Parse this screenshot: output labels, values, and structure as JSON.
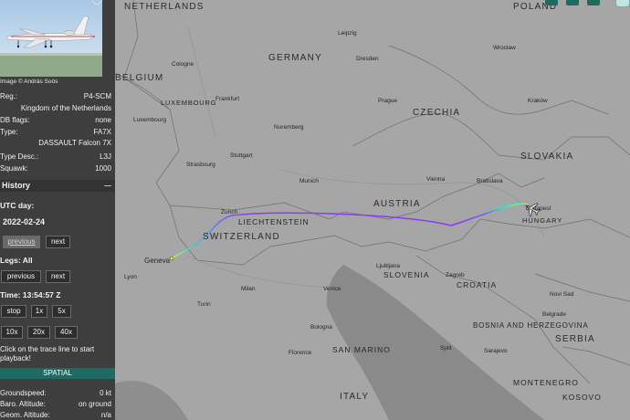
{
  "aircraft": {
    "photo_credit": "Image © András Soós",
    "reg_label": "Reg.:",
    "reg_value": "P4-SCM",
    "country": "Kingdom of the Netherlands",
    "db_flags_label": "DB flags:",
    "db_flags_value": "none",
    "type_label": "Type:",
    "type_value": "FA7X",
    "model": "DASSAULT Falcon 7X",
    "type_desc_label": "Type Desc.:",
    "type_desc_value": "L3J",
    "squawk_label": "Squawk:",
    "squawk_value": "1000"
  },
  "history": {
    "title": "History",
    "utc_day_label": "UTC day:",
    "date": "2022-02-24",
    "prev_label": "previous",
    "next_label": "next",
    "legs_label": "Legs: All",
    "time_label": "Time: 13:54:57 Z",
    "stop_label": "stop",
    "speeds": [
      "1x",
      "5x",
      "10x",
      "20x",
      "40x"
    ],
    "hint": "Click on the trace line to start playback!"
  },
  "spatial": {
    "title": "SPATIAL",
    "groundspeed_label": "Groundspeed:",
    "groundspeed_value": "0 kt",
    "baro_label": "Baro. Altitude:",
    "baro_value": "on ground",
    "geom_label": "Geom. Altitude:",
    "geom_value": "n/a"
  },
  "map": {
    "countries": [
      "NETHERLANDS",
      "GERMANY",
      "BELGIUM",
      "LUXEMBOURG",
      "CZECHIA",
      "POLAND",
      "SLOVAKIA",
      "AUSTRIA",
      "LIECHTENSTEIN",
      "SWITZERLAND",
      "HUNGARY",
      "SLOVENIA",
      "CROATIA",
      "SAN MARINO",
      "ITALY",
      "BOSNIA AND HERZEGOVINA",
      "SERBIA",
      "MONTENEGRO",
      "KOSOVO"
    ],
    "cities": [
      "Cologne",
      "Leipzig",
      "Dresden",
      "Wrocław",
      "Kraków",
      "Frankfurt",
      "Prague",
      "Nuremberg",
      "Strasbourg",
      "Stuttgart",
      "Munich",
      "Vienna",
      "Bratislava",
      "Budapest",
      "Zurich",
      "Geneva",
      "Lyon",
      "Turin",
      "Milan",
      "Venice",
      "Ljubljana",
      "Zagreb",
      "Bologna",
      "Florence",
      "Belgrade",
      "Sarajevo",
      "Luxembourg",
      "Split",
      "Novi Sad"
    ]
  }
}
